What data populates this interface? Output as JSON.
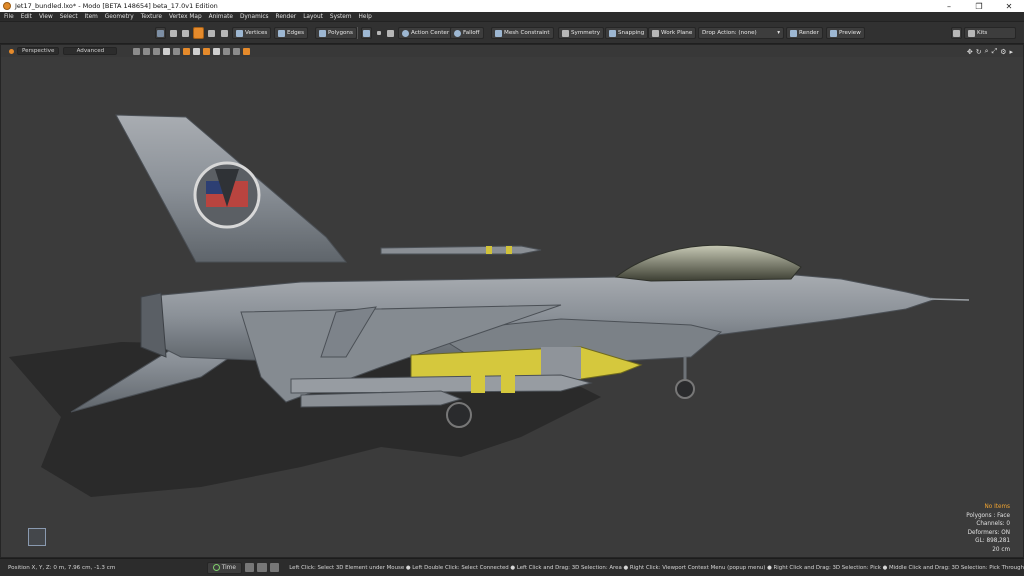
{
  "window": {
    "title": "Jet17_bundled.lxo* - Modo [BETA 148654]  beta_17.0v1 Edition",
    "minimize": "–",
    "maximize": "❐",
    "close": "✕"
  },
  "menu": [
    "File",
    "Edit",
    "View",
    "Select",
    "Item",
    "Geometry",
    "Texture",
    "Vertex Map",
    "Animate",
    "Dynamics",
    "Render",
    "Layout",
    "System",
    "Help"
  ],
  "toolbar": {
    "vertices": "Vertices",
    "edges": "Edges",
    "polygons": "Polygons",
    "action_center": "Action Center",
    "falloff": "Falloff",
    "mesh_constraint": "Mesh Constraint",
    "symmetry": "Symmetry",
    "snapping": "Snapping",
    "work_plane": "Work Plane",
    "drop_action": "Drop Action: (none)",
    "render": "Render",
    "preview": "Preview",
    "kits": "Kits"
  },
  "viewport": {
    "view_mode": "Perspective",
    "shading_mode": "Advanced",
    "info": {
      "selection": "No Items",
      "polygons": "Polygons : Face",
      "channels": "Channels: 0",
      "deformers": "Deformers: ON",
      "gl": "GL: 898,281",
      "scale": "20 cm"
    }
  },
  "status": {
    "position": "Position X, Y, Z:  0 m, 7.96 cm, -1.3 cm",
    "time": "Time",
    "hint": "Left Click: Select 3D Element under Mouse ● Left Double Click: Select Connected ● Left Click and Drag: 3D Selection: Area ● Right Click: Viewport Context Menu (popup menu) ● Right Click and Drag: 3D Selection: Pick ● Middle Click and Drag: 3D Selection: Pick Through"
  },
  "colors": {
    "accent": "#e58a2b",
    "background": "#3b3b3b",
    "highlight": "#f0a330"
  }
}
